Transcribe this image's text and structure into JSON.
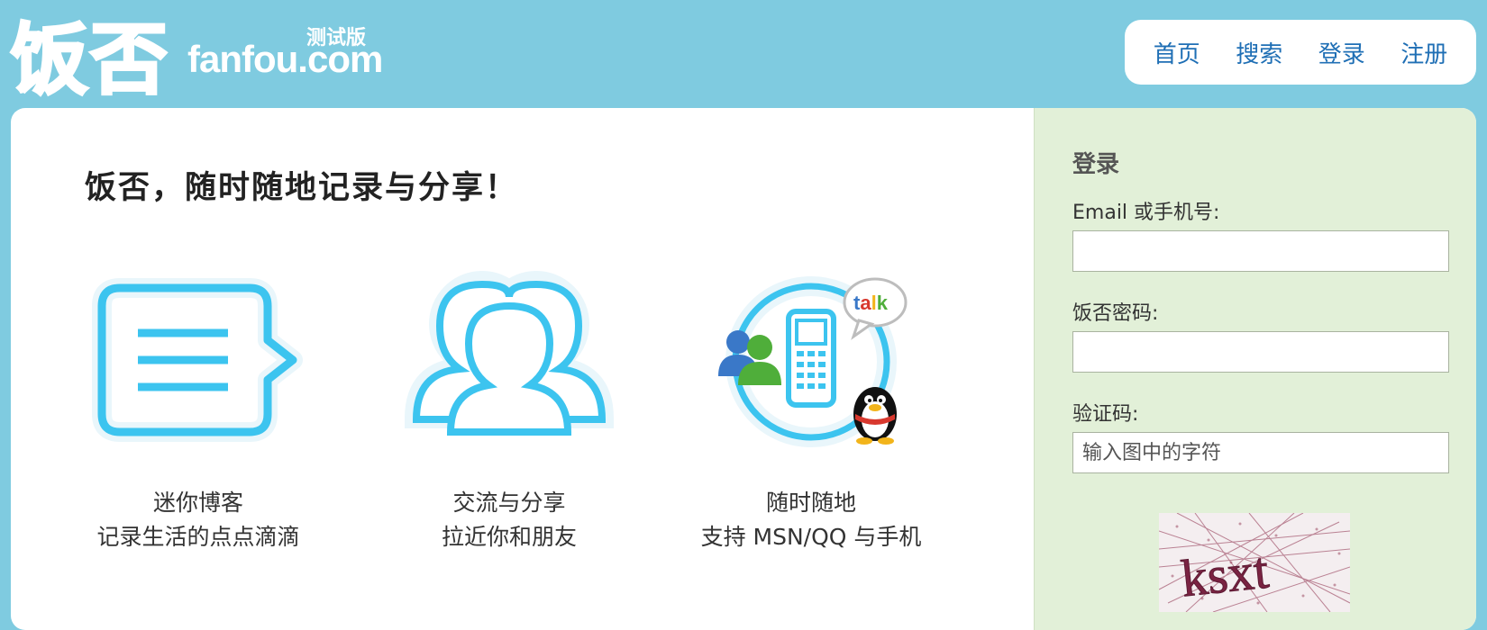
{
  "header": {
    "logo_cn": "饭否",
    "logo_en": "fanfou.com",
    "logo_badge": "测试版",
    "nav": [
      {
        "label": "首页"
      },
      {
        "label": "搜索"
      },
      {
        "label": "登录"
      },
      {
        "label": "注册"
      }
    ]
  },
  "main": {
    "headline": "饭否，随时随地记录与分享！",
    "features": [
      {
        "icon": "speech-bubble-icon",
        "line1": "迷你博客",
        "line2": "记录生活的点点滴滴"
      },
      {
        "icon": "people-icon",
        "line1": "交流与分享",
        "line2": "拉近你和朋友"
      },
      {
        "icon": "phone-im-icon",
        "line1": "随时随地",
        "line2": "支持 MSN/QQ 与手机"
      }
    ]
  },
  "login": {
    "title": "登录",
    "email_label": "Email 或手机号:",
    "email_value": "",
    "password_label": "饭否密码:",
    "password_value": "",
    "captcha_label": "验证码:",
    "captcha_placeholder": "输入图中的字符",
    "captcha_text": "ksxt"
  },
  "colors": {
    "page_bg": "#7fcbe0",
    "accent_blue": "#3cc4ef",
    "nav_link": "#1f6fb5",
    "sidebar_bg": "#e2f0d8"
  }
}
